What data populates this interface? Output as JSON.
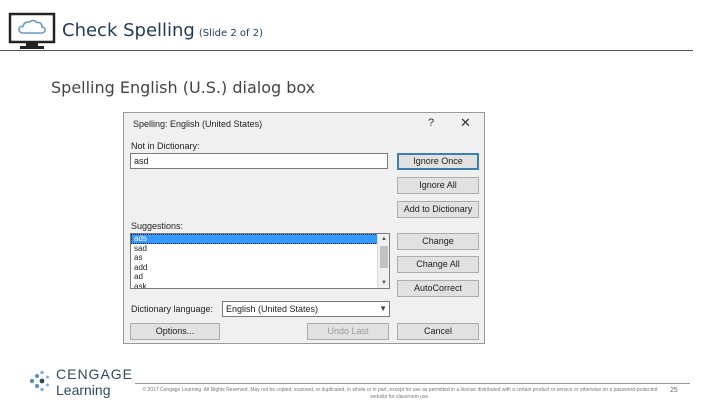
{
  "slide": {
    "title": "Check Spelling",
    "title_sub": "(Slide 2 of 2)",
    "subtitle": "Spelling English (U.S.) dialog box",
    "page_number": "25",
    "copyright": "© 2017 Cengage Learning. All Rights Reserved. May not be copied, scanned, or duplicated, in whole or in part, except for use as permitted in a license distributed with a certain product or service or otherwise on a password-protected website for classroom use.",
    "logo": {
      "line1": "CENGAGE",
      "line2": "Learning"
    }
  },
  "dialog": {
    "title": "Spelling: English (United States)",
    "help_label": "?",
    "close_label": "✕",
    "not_in_dictionary_label": "Not in Dictionary:",
    "not_in_dictionary_value": "asd",
    "suggestions_label": "Suggestions:",
    "suggestions": [
      "ads",
      "sad",
      "as",
      "add",
      "ad",
      "ask"
    ],
    "dictionary_language_label": "Dictionary language:",
    "dictionary_language_value": "English (United States)",
    "buttons": {
      "ignore_once": "Ignore Once",
      "ignore_all": "Ignore All",
      "add_to_dictionary": "Add to Dictionary",
      "change": "Change",
      "change_all": "Change All",
      "autocorrect": "AutoCorrect",
      "options": "Options...",
      "undo_last": "Undo Last",
      "cancel": "Cancel"
    }
  },
  "colors": {
    "title": "#1f3a5a",
    "selection": "#3399ff",
    "dialog_bg": "#f0f0f0"
  }
}
